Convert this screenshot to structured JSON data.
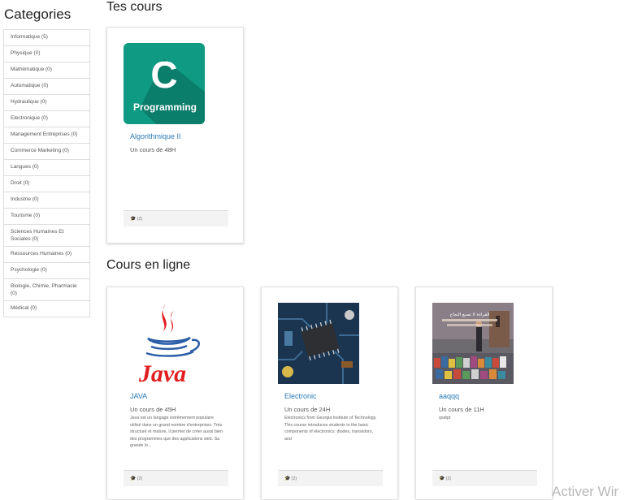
{
  "sidebar": {
    "title": "Categories",
    "items": [
      {
        "label": "Informatique (5)"
      },
      {
        "label": "Physique (0)"
      },
      {
        "label": "Mathématique (0)"
      },
      {
        "label": "Automatique (0)"
      },
      {
        "label": "Hydraulique (0)"
      },
      {
        "label": "Electronique (0)"
      },
      {
        "label": "Management   Entreprises (0)"
      },
      {
        "label": "Commerce   Marketing (0)"
      },
      {
        "label": "Langues (0)"
      },
      {
        "label": "Droit (0)"
      },
      {
        "label": "Industrie (0)"
      },
      {
        "label": "Tourisme (0)"
      },
      {
        "label": "Sciences Humaines Et Sociales (0)"
      },
      {
        "label": "Ressources Humaines (0)"
      },
      {
        "label": "Psychologie (0)"
      },
      {
        "label": "Biologie, Chimie, Pharmacie (0)"
      },
      {
        "label": "Médical (0)"
      }
    ]
  },
  "my_courses": {
    "title": "Tes cours",
    "cards": [
      {
        "title": "Algorithmique II",
        "subtitle": "Un cours de 48H",
        "description": "",
        "footer": "(2)",
        "image_letter": "C",
        "image_caption": "Programming"
      }
    ]
  },
  "online_courses": {
    "title": "Cours en ligne",
    "cards": [
      {
        "title": "JAVA",
        "subtitle": "Un cours de 45H",
        "description": "Java est un langage extrêmement populaire utilisé dans un grand nombre d'entreprises. Très structuré et mature, il permet de créer aussi bien des programmes que des applications web. Sa grande lo...",
        "footer": "(2)",
        "logo_text": "Java"
      },
      {
        "title": "Electronic",
        "subtitle": "Un cours de 24H",
        "description": "Electronics from Georgia Institute of Technology. This course introduces students to the basic components of electronics: diodes, transistors, and",
        "footer": "(2)"
      },
      {
        "title": "aaqqq",
        "subtitle": "Un cours de 11H",
        "description": "qsdqd",
        "footer": "(2)",
        "image_text": "القراءة لا تصنع النجاح"
      }
    ]
  },
  "watermark": "Activer Wir",
  "colors": {
    "link": "#2a7ab8",
    "c_logo_bg": "#0f9a84",
    "java_red": "#e11f21",
    "java_blue": "#2c5ea8"
  }
}
